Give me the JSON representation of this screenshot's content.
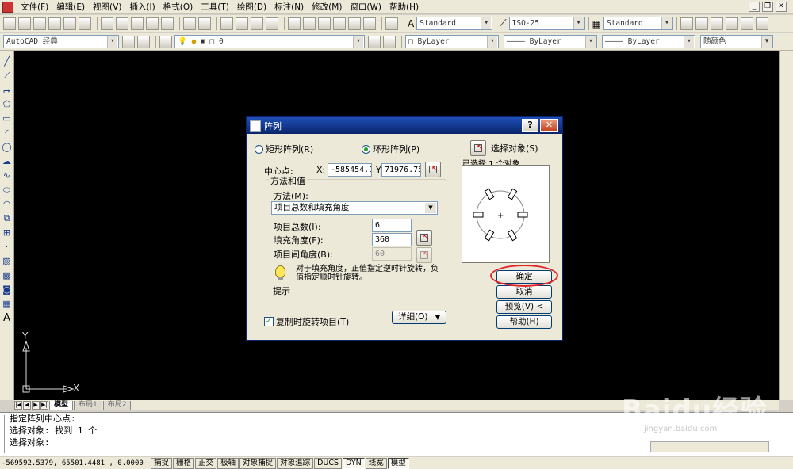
{
  "menu": {
    "items": [
      "文件(F)",
      "编辑(E)",
      "视图(V)",
      "插入(I)",
      "格式(O)",
      "工具(T)",
      "绘图(D)",
      "标注(N)",
      "修改(M)",
      "窗口(W)",
      "帮助(H)"
    ]
  },
  "toolbar": {
    "text_style": "Standard",
    "dim_style": "ISO-25",
    "table_style": "Standard",
    "workspace": "AutoCAD 经典",
    "layer": "0",
    "color": "ByLayer",
    "linetype": "ByLayer",
    "lineweight": "ByLayer",
    "plot_style": "随颜色"
  },
  "drawing_area": {
    "ucs_x": "X",
    "ucs_y": "Y"
  },
  "layout_tabs": [
    "模型",
    "布局1",
    "布局2"
  ],
  "command_line": {
    "lines": [
      "指定阵列中心点:",
      "选择对象: 找到 1 个",
      "选择对象:"
    ]
  },
  "status": {
    "coordinates": "-569592.5379, 65501.4481 , 0.0000",
    "buttons": [
      "捕捉",
      "栅格",
      "正交",
      "极轴",
      "对象捕捉",
      "对象追踪",
      "DUCS",
      "DYN",
      "线宽",
      "模型"
    ]
  },
  "dialog": {
    "title": "阵列",
    "help_btn": "?",
    "close_btn": "✕",
    "rect_array": "矩形阵列(R)",
    "polar_array": "环形阵列(P)",
    "center_label": "中心点:",
    "x_label": "X:",
    "x_value": "-585454.1",
    "y_label": "Y:",
    "y_value": "71976.751",
    "method_group": "方法和值",
    "method_label": "方法(M):",
    "method_value": "项目总数和填充角度",
    "total_label": "项目总数(I):",
    "total_value": "6",
    "fill_label": "填充角度(F):",
    "fill_value": "360",
    "between_label": "项目间角度(B):",
    "between_value": "60",
    "hint_text": "对于填充角度，正值指定逆时针旋转，负值指定顺时针旋转。",
    "hint_label": "提示",
    "rotate_label": "复制时旋转项目(T)",
    "more_btn": "详细(O)",
    "more_arrow": "▼",
    "select_label": "选择对象(S)",
    "selected_count": "已选择 1 个对象",
    "ok_btn": "确定",
    "cancel_btn": "取消",
    "preview_btn": "预览(V) <",
    "help_label": "帮助(H)"
  },
  "watermark": {
    "text": "Baidu经验",
    "url": "jingyan.baidu.com"
  }
}
